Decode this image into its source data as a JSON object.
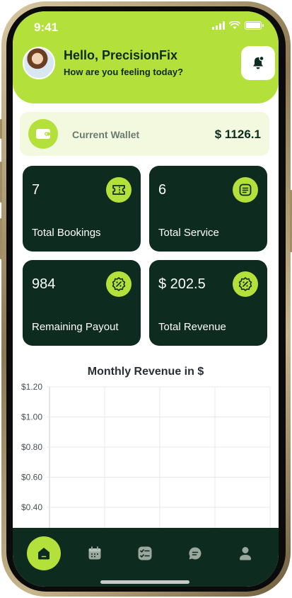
{
  "status_bar": {
    "time": "9:41"
  },
  "header": {
    "greeting": "Hello, PrecisionFix",
    "subtitle": "How are you feeling today?"
  },
  "wallet": {
    "label": "Current Wallet",
    "amount": "$ 1126.1"
  },
  "stats": [
    {
      "value": "7",
      "label": "Total Bookings",
      "icon": "ticket-icon"
    },
    {
      "value": "6",
      "label": "Total Service",
      "icon": "list-icon"
    },
    {
      "value": "984",
      "label": "Remaining Payout",
      "icon": "percent-badge-icon"
    },
    {
      "value": "$ 202.5",
      "label": "Total Revenue",
      "icon": "percent-badge-icon"
    }
  ],
  "chart_data": {
    "type": "line",
    "title": "Monthly Revenue in $",
    "y_ticks": [
      "$1.20",
      "$1.00",
      "$0.80",
      "$0.60",
      "$0.40"
    ],
    "y_tick_values": [
      1.2,
      1.0,
      0.8,
      0.6,
      0.4
    ],
    "grid": true,
    "series": []
  },
  "nav": {
    "items": [
      {
        "icon": "home-icon",
        "active": true
      },
      {
        "icon": "calendar-icon",
        "active": false
      },
      {
        "icon": "checklist-icon",
        "active": false
      },
      {
        "icon": "chat-icon",
        "active": false
      },
      {
        "icon": "profile-icon",
        "active": false
      }
    ]
  },
  "colors": {
    "accent": "#b3e03a",
    "dark": "#0d2b1e",
    "wallet_bg": "#f2f9df"
  }
}
